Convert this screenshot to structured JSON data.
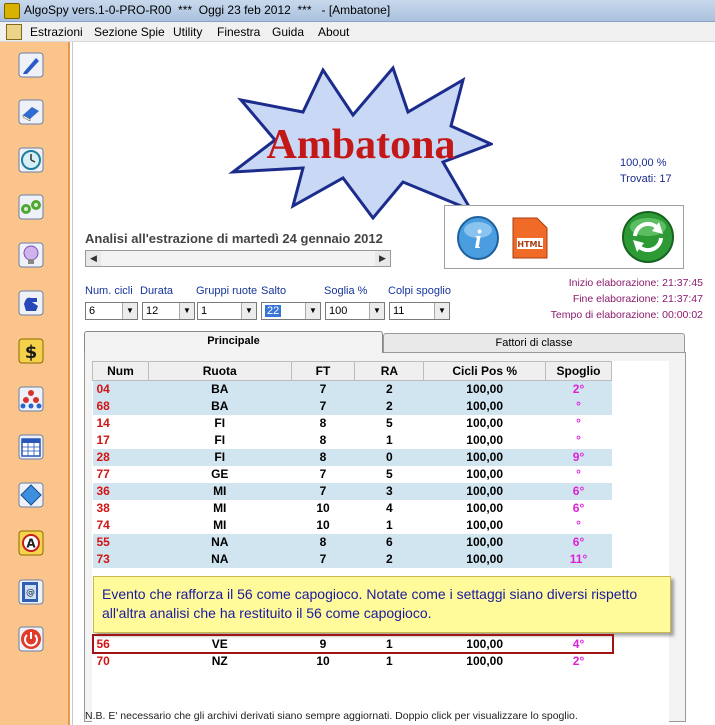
{
  "window": {
    "title": "AlgoSpy vers.1-0-PRO-R00  ***  Oggi 23 feb 2012  ***   - [Ambatone]"
  },
  "menu": [
    "Estrazioni",
    "Sezione Spie",
    "Utility",
    "Finestra",
    "Guida",
    "About"
  ],
  "sidebar_icons": [
    "pencil-icon",
    "book-icon",
    "clock-icon",
    "binoculars-icon",
    "lightbulb-icon",
    "hand-icon",
    "dollar-icon",
    "pyramid-icon",
    "calendar-icon",
    "diamond-icon",
    "letter-a-icon",
    "contact-card-icon",
    "power-icon"
  ],
  "logo": {
    "text": "Ambatona"
  },
  "stats": {
    "percent": "100,00 %",
    "trovati": "Trovati: 17"
  },
  "analysis_title": "Analisi all'estrazione di martedì 24 gennaio 2012",
  "times": {
    "inizio": "Inizio elaborazione: 21:37:45",
    "fine": "Fine elaborazione: 21:37:47",
    "tempo": "Tempo di elaborazione: 00:00:02"
  },
  "controls": {
    "num_cicli": {
      "label": "Num. cicli",
      "value": "6"
    },
    "durata": {
      "label": "Durata",
      "value": "12"
    },
    "gruppi_ruote": {
      "label": "Gruppi ruote",
      "value": "1"
    },
    "salto": {
      "label": "Salto",
      "value": "22"
    },
    "soglia": {
      "label": "Soglia %",
      "value": "100"
    },
    "colpi_spoglio": {
      "label": "Colpi spoglio",
      "value": "11"
    }
  },
  "tabs": {
    "principale": "Principale",
    "fattori": "Fattori di classe"
  },
  "table": {
    "headers": [
      "Num",
      "Ruota",
      "FT",
      "RA",
      "Cicli Pos %",
      "Spoglio"
    ],
    "rows": [
      [
        "04",
        "BA",
        "7",
        "2",
        "100,00",
        "2°"
      ],
      [
        "68",
        "BA",
        "7",
        "2",
        "100,00",
        "°"
      ],
      [
        "14",
        "FI",
        "8",
        "5",
        "100,00",
        "°"
      ],
      [
        "17",
        "FI",
        "8",
        "1",
        "100,00",
        "°"
      ],
      [
        "28",
        "FI",
        "8",
        "0",
        "100,00",
        "9°"
      ],
      [
        "77",
        "GE",
        "7",
        "5",
        "100,00",
        "°"
      ],
      [
        "36",
        "MI",
        "7",
        "3",
        "100,00",
        "6°"
      ],
      [
        "38",
        "MI",
        "10",
        "4",
        "100,00",
        "6°"
      ],
      [
        "74",
        "MI",
        "10",
        "1",
        "100,00",
        "°"
      ],
      [
        "55",
        "NA",
        "8",
        "6",
        "100,00",
        "6°"
      ],
      [
        "73",
        "NA",
        "7",
        "2",
        "100,00",
        "11°"
      ],
      [
        "56",
        "VE",
        "9",
        "1",
        "100,00",
        "4°"
      ],
      [
        "70",
        "NZ",
        "10",
        "1",
        "100,00",
        "2°"
      ]
    ]
  },
  "callout": "Evento che rafforza il 56 come capogioco. Notate come i settaggi siano diversi rispetto all'altra analisi che ha restituito il 56 come capogioco.",
  "footer_note": "N.B. E' necessario che gli archivi derivati siano sempre aggiornati. Doppio click per visualizzare lo spoglio."
}
